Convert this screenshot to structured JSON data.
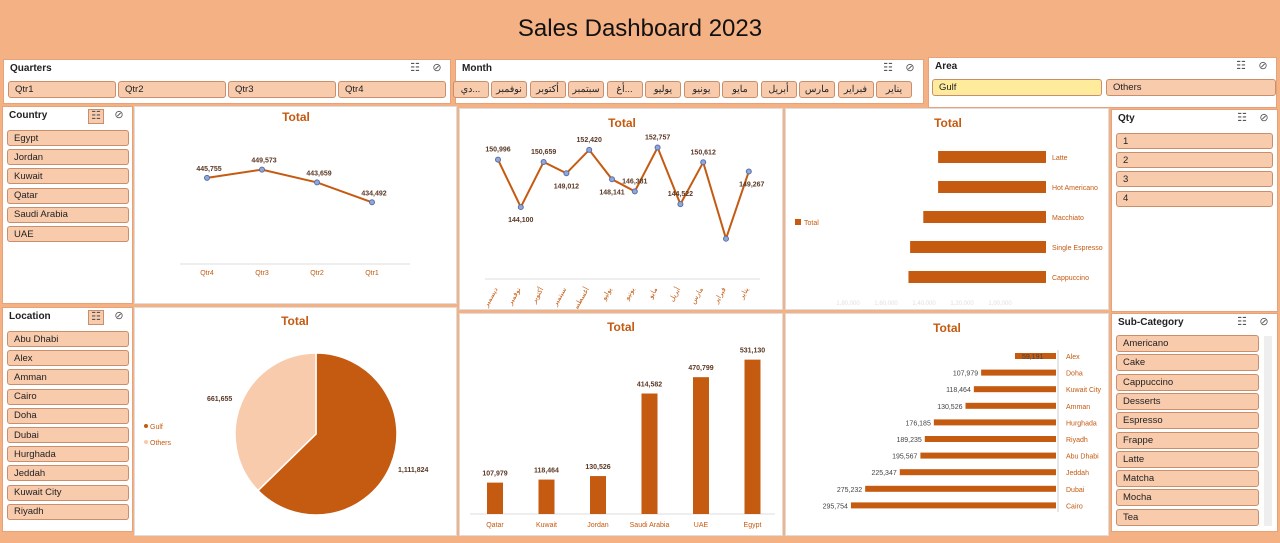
{
  "dashboard": {
    "title": "Sales Dashboard 2023"
  },
  "slicers": {
    "quarters": {
      "title": "Quarters",
      "items": [
        "Qtr1",
        "Qtr2",
        "Qtr3",
        "Qtr4"
      ]
    },
    "month": {
      "title": "Month",
      "items": [
        "يناير",
        "فبراير",
        "مارس",
        "أبريل",
        "مايو",
        "يونيو",
        "يوليو",
        "أغ...",
        "سبتمبر",
        "أكتوبر",
        "نوفمبر",
        "دي..."
      ]
    },
    "area": {
      "title": "Area",
      "items": [
        "Gulf",
        "Others"
      ],
      "selected": "Gulf"
    },
    "country": {
      "title": "Country",
      "items": [
        "Egypt",
        "Jordan",
        "Kuwait",
        "Qatar",
        "Saudi Arabia",
        "UAE"
      ]
    },
    "qty": {
      "title": "Qty",
      "items": [
        "1",
        "2",
        "3",
        "4"
      ]
    },
    "location": {
      "title": "Location",
      "items": [
        "Abu Dhabi",
        "Alex",
        "Amman",
        "Cairo",
        "Doha",
        "Dubai",
        "Hurghada",
        "Jeddah",
        "Kuwait City",
        "Riyadh"
      ]
    },
    "subcategory": {
      "title": "Sub-Category",
      "items": [
        "Americano",
        "Cake",
        "Cappuccino",
        "Desserts",
        "Espresso",
        "Frappe",
        "Latte",
        "Matcha",
        "Mocha",
        "Tea"
      ]
    }
  },
  "icons": {
    "multiselect": "multi-select-icon",
    "clear": "clear-filter-icon"
  },
  "colors": {
    "accent": "#c55a11",
    "light": "#f8cbad",
    "header": "#f4b183",
    "selected": "#ffeb9c"
  },
  "chart_data": [
    {
      "id": "quarters_line",
      "type": "line",
      "title": "Total",
      "categories": [
        "Qtr4",
        "Qtr3",
        "Qtr2",
        "Qtr1"
      ],
      "labels": [
        "445,755",
        "449,573",
        "443,659",
        "434,492"
      ],
      "values": [
        445755,
        449573,
        443659,
        434492
      ],
      "ylim": [
        400000,
        460000
      ]
    },
    {
      "id": "month_line",
      "type": "line",
      "title": "Total",
      "categories": [
        "ديسمبر",
        "نوفمبر",
        "أكتوبر",
        "سبتمبر",
        "أغسطس",
        "يوليو",
        "يونيو",
        "مايو",
        "أبريل",
        "مارس",
        "فبراير",
        "يناير"
      ],
      "labels": [
        "150,996",
        "144,100",
        "150,659",
        "149,012",
        "152,420",
        "148,141",
        "146,381",
        "152,757",
        "144,522",
        "150,612",
        "",
        "149,267"
      ],
      "values": [
        150996,
        144100,
        150659,
        149012,
        152420,
        148141,
        146381,
        152757,
        144522,
        150612,
        139500,
        149267
      ],
      "ylim": [
        138000,
        154000
      ]
    },
    {
      "id": "product_bar",
      "type": "bar",
      "title": "Total",
      "legend": "Total",
      "categories": [
        "Latte",
        "Hot Americano",
        "Macchiato",
        "Single Espresso",
        "Cappuccino"
      ],
      "values": [
        131000,
        131000,
        149000,
        165000,
        167000
      ],
      "ticks": [
        "1,80,000",
        "1,60,000",
        "1,40,000",
        "1,20,000",
        "1,00,000"
      ]
    },
    {
      "id": "area_pie",
      "type": "pie",
      "title": "Total",
      "legend": [
        "Gulf",
        "Others"
      ],
      "labels": [
        "1,111,824",
        "661,655"
      ],
      "values": [
        1111824,
        661655
      ]
    },
    {
      "id": "country_bar",
      "type": "bar",
      "title": "Total",
      "categories": [
        "Qatar",
        "Kuwait",
        "Jordan",
        "Saudi Arabia",
        "UAE",
        "Egypt"
      ],
      "labels": [
        "107,979",
        "118,464",
        "130,526",
        "414,582",
        "470,799",
        "531,130"
      ],
      "values": [
        107979,
        118464,
        130526,
        414582,
        470799,
        531130
      ],
      "ylim": [
        0,
        560000
      ]
    },
    {
      "id": "location_bar",
      "type": "bar",
      "title": "Total",
      "categories": [
        "Alex",
        "Doha",
        "Kuwait City",
        "Amman",
        "Hurghada",
        "Riyadh",
        "Abu Dhabi",
        "Jeddah",
        "Dubai",
        "Cairo"
      ],
      "labels": [
        "59,191",
        "107,979",
        "118,464",
        "130,526",
        "176,185",
        "189,235",
        "195,567",
        "225,347",
        "275,232",
        "295,754"
      ],
      "values": [
        59191,
        107979,
        118464,
        130526,
        176185,
        189235,
        195567,
        225347,
        275232,
        295754
      ],
      "xlim": [
        0,
        300000
      ]
    }
  ]
}
